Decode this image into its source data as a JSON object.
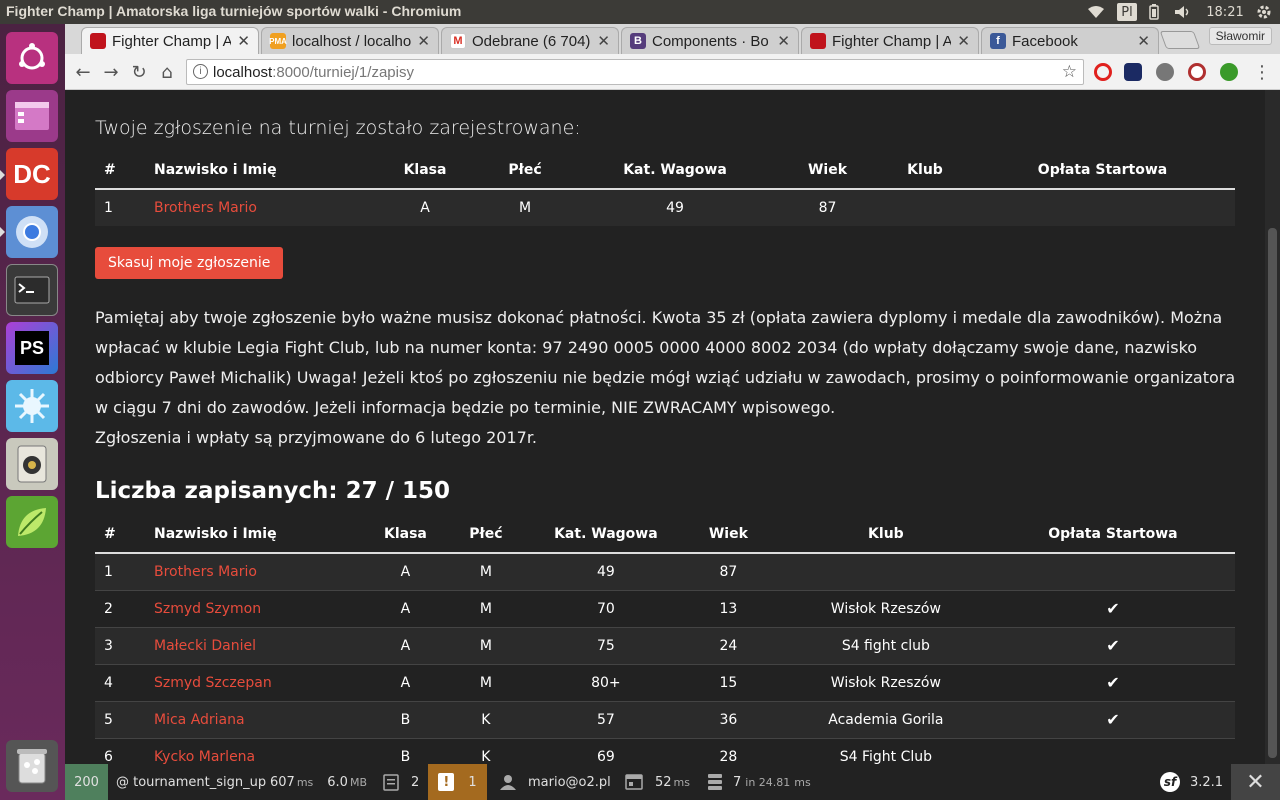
{
  "window": {
    "title": "Fighter Champ | Amatorska liga turniejów sportów walki - Chromium",
    "keyboard": "Pl",
    "clock": "18:21"
  },
  "tabs": [
    {
      "label": "Fighter Champ | A",
      "icon": "boxing-glove-icon",
      "active": true
    },
    {
      "label": "localhost / localho",
      "icon": "phpmyadmin-icon",
      "active": false
    },
    {
      "label": "Odebrane (6 704)",
      "icon": "gmail-icon",
      "active": false
    },
    {
      "label": "Components · Bo",
      "icon": "bootstrap-icon",
      "active": false
    },
    {
      "label": "Fighter Champ | A",
      "icon": "boxing-glove-icon",
      "active": false
    },
    {
      "label": "Facebook",
      "icon": "facebook-icon",
      "active": false
    }
  ],
  "profile": "Sławomir",
  "url": {
    "host": "localhost",
    "rest": ":8000/turniej/1/zapisy"
  },
  "registration": {
    "heading": "Twoje zgłoszenie na turniej zostało zarejestrowane:",
    "headers": [
      "#",
      "Nazwisko i Imię",
      "Klasa",
      "Płeć",
      "Kat. Wagowa",
      "Wiek",
      "Klub",
      "Opłata Startowa"
    ],
    "row": {
      "num": "1",
      "name": "Brothers Mario",
      "klasa": "A",
      "plec": "M",
      "waga": "49",
      "wiek": "87",
      "klub": "",
      "oplata": ""
    }
  },
  "cancel_button": "Skasuj moje zgłoszenie",
  "notice": {
    "line1": "Pamiętaj aby twoje zgłoszenie było ważne musisz dokonać płatności. Kwota 35 zł (opłata zawiera dyplomy i medale dla zawodników). Można wpłacać w klubie Legia Fight Club, lub na numer konta: 97 2490 0005 0000 4000 8002 2034 (do wpłaty dołączamy swoje dane, nazwisko odbiorcy Paweł Michalik) Uwaga! Jeżeli ktoś po zgłoszeniu nie będzie mógł wziąć udziału w zawodach, prosimy o poinformowanie organizatora w ciągu 7 dni do zawodów. Jeżeli informacja będzie po terminie, NIE ZWRACAMY wpisowego.",
    "line2": "Zgłoszenia i wpłaty są przyjmowane do 6 lutego 2017r."
  },
  "participants": {
    "count_label": "Liczba zapisanych: 27 / 150",
    "headers": [
      "#",
      "Nazwisko i Imię",
      "Klasa",
      "Płeć",
      "Kat. Wagowa",
      "Wiek",
      "Klub",
      "Opłata Startowa"
    ],
    "rows": [
      {
        "num": "1",
        "name": "Brothers Mario",
        "klasa": "A",
        "plec": "M",
        "waga": "49",
        "wiek": "87",
        "klub": "",
        "paid": false
      },
      {
        "num": "2",
        "name": "Szmyd Szymon",
        "klasa": "A",
        "plec": "M",
        "waga": "70",
        "wiek": "13",
        "klub": "Wisłok Rzeszów",
        "paid": true
      },
      {
        "num": "3",
        "name": "Małecki Daniel",
        "klasa": "A",
        "plec": "M",
        "waga": "75",
        "wiek": "24",
        "klub": "S4 fight club",
        "paid": true
      },
      {
        "num": "4",
        "name": "Szmyd Szczepan",
        "klasa": "A",
        "plec": "M",
        "waga": "80+",
        "wiek": "15",
        "klub": "Wisłok Rzeszów",
        "paid": true
      },
      {
        "num": "5",
        "name": "Mica Adriana",
        "klasa": "B",
        "plec": "K",
        "waga": "57",
        "wiek": "36",
        "klub": "Academia Gorila",
        "paid": true
      },
      {
        "num": "6",
        "name": "Kycko Marlena",
        "klasa": "B",
        "plec": "K",
        "waga": "69",
        "wiek": "28",
        "klub": "S4 Fight Club",
        "paid": false
      }
    ],
    "paid_mark": "✔"
  },
  "debug_toolbar": {
    "status": "200",
    "route": "@ tournament_sign_up",
    "time": "607",
    "time_unit": "ms",
    "memory": "6.0",
    "memory_unit": "MB",
    "forms": "2",
    "warnings": "1",
    "user": "mario@o2.pl",
    "render_time": "52",
    "render_unit": "ms",
    "queries": "7",
    "query_text": "in 24.81",
    "query_unit": "ms",
    "version": "3.2.1",
    "colors": {
      "status_ok": "#4f805d",
      "warning": "#a46a1f"
    }
  }
}
